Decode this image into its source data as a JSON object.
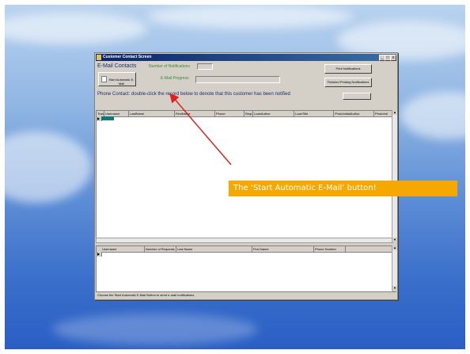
{
  "window": {
    "title": "Customer Contact Screen",
    "minimize": "_",
    "maximize": "□",
    "close": "x"
  },
  "email": {
    "heading": "E-Mail Contacts",
    "notifications_label": "Number of Notifications",
    "start_button_label": "Start Automatic E-Mail",
    "progress_label": "E-Mail Progress"
  },
  "side_buttons": {
    "print_label": "Print Notifications",
    "finished_label": "Finished Printing Notifications"
  },
  "phone": {
    "instructions": "Phone Contact: double-click the record below to denote that this customer has been notified"
  },
  "top_grid": {
    "columns": [
      "Transid",
      "Username",
      "LastName",
      "FirstName",
      "Phone",
      "Requ",
      "LoanAuthor",
      "LoanTitle",
      "PhotoInitialAuthor",
      "PhotoInit"
    ]
  },
  "bottom_grid": {
    "columns": [
      "Username",
      "Number of Requests",
      "Last Name",
      "First Name",
      "Phone Number"
    ]
  },
  "status_bar": {
    "text": "Choose the Start Automatic E-Mail Button to send e-mail notifications."
  },
  "callout": {
    "text": "The ‘Start Automatic E-Mail’ button!",
    "color": "#f5a800"
  },
  "arrow": {
    "color": "#e02020"
  }
}
